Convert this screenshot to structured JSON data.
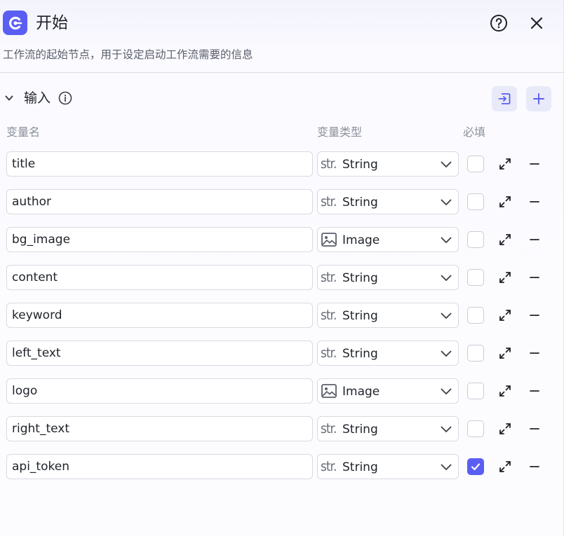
{
  "header": {
    "title": "开始",
    "description": "工作流的起始节点，用于设定启动工作流需要的信息"
  },
  "section": {
    "title": "输入",
    "columns": {
      "name": "变量名",
      "type": "变量类型",
      "required": "必填"
    }
  },
  "rows": [
    {
      "name": "title",
      "type": "String",
      "type_icon": "str-icon",
      "required": false
    },
    {
      "name": "author",
      "type": "String",
      "type_icon": "str-icon",
      "required": false
    },
    {
      "name": "bg_image",
      "type": "Image",
      "type_icon": "image-icon",
      "required": false
    },
    {
      "name": "content",
      "type": "String",
      "type_icon": "str-icon",
      "required": false
    },
    {
      "name": "keyword",
      "type": "String",
      "type_icon": "str-icon",
      "required": false
    },
    {
      "name": "left_text",
      "type": "String",
      "type_icon": "str-icon",
      "required": false
    },
    {
      "name": "logo",
      "type": "Image",
      "type_icon": "image-icon",
      "required": false
    },
    {
      "name": "right_text",
      "type": "String",
      "type_icon": "str-icon",
      "required": false
    },
    {
      "name": "api_token",
      "type": "String",
      "type_icon": "str-icon",
      "required": true
    }
  ],
  "str_glyph": "str.",
  "colors": {
    "accent": "#5b5ef2",
    "button_bg": "#e8e9f9"
  }
}
